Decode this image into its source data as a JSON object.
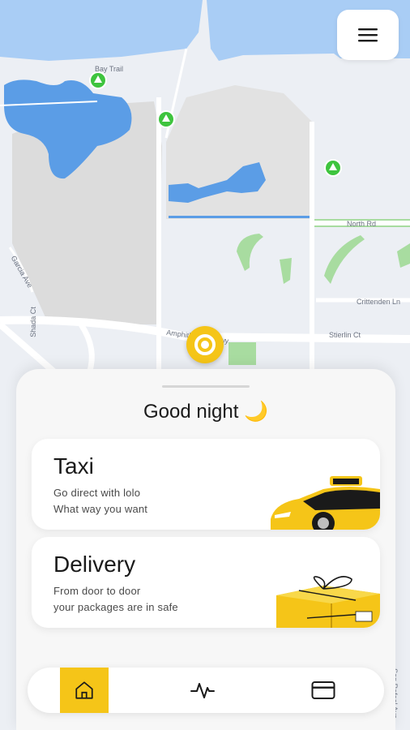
{
  "map": {
    "labels": {
      "bay_trail": "Bay Trail",
      "north_rd": "North Rd",
      "crittenden": "Crittenden Ln",
      "stierlin": "Stierlin Ct",
      "amphitheatre": "Amphitheatre Pkwy",
      "garcia": "Garcia Ave",
      "shada": "Shada Ct",
      "san_rafael": "San Rafael Ave"
    }
  },
  "greeting": {
    "text": "Good night",
    "emoji": "🌙"
  },
  "services": [
    {
      "title": "Taxi",
      "line1": "Go direct with lolo",
      "line2": "What way you want",
      "image": "taxi-car-illustration"
    },
    {
      "title": "Delivery",
      "line1": "From door to door",
      "line2": "your packages are in safe",
      "image": "gift-box-illustration"
    }
  ],
  "nav": {
    "items": [
      {
        "name": "home",
        "icon": "home-icon",
        "active": true
      },
      {
        "name": "activity",
        "icon": "activity-icon",
        "active": false
      },
      {
        "name": "payment",
        "icon": "credit-card-icon",
        "active": false
      }
    ]
  },
  "colors": {
    "accent": "#f5c518",
    "water": "#5b9de6",
    "park": "#a8dca0",
    "marker": "#3ec43e"
  }
}
